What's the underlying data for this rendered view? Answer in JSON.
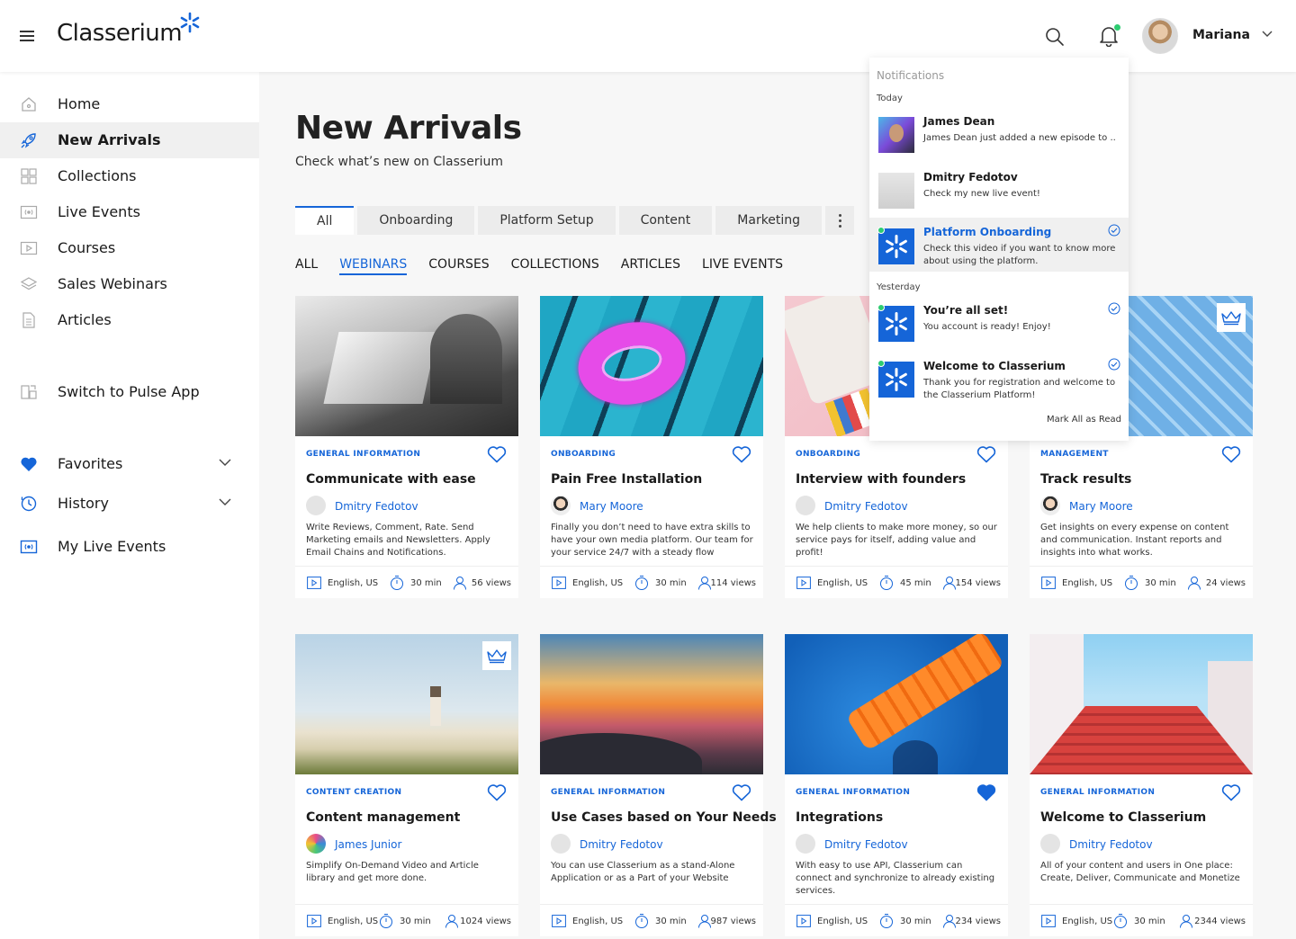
{
  "header": {
    "logo": "Classerium",
    "user_name": "Mariana"
  },
  "sidebar": {
    "items": [
      {
        "label": "Home",
        "icon": "home-icon"
      },
      {
        "label": "New Arrivals",
        "icon": "rocket-icon",
        "active": true
      },
      {
        "label": "Collections",
        "icon": "grid-icon"
      },
      {
        "label": "Live Events",
        "icon": "broadcast-icon"
      },
      {
        "label": "Courses",
        "icon": "play-icon"
      },
      {
        "label": "Sales Webinars",
        "icon": "layers-icon"
      },
      {
        "label": "Articles",
        "icon": "document-icon"
      }
    ],
    "switch_label": "Switch to Pulse App",
    "favorites_label": "Favorites",
    "history_label": "History",
    "my_live_events_label": "My Live Events"
  },
  "main": {
    "title": "New Arrivals",
    "subtitle": "Check what’s new on Classerium",
    "tabs": [
      "All",
      "Onboarding",
      "Platform Setup",
      "Content",
      "Marketing"
    ],
    "subtabs": [
      "ALL",
      "WEBINARS",
      "COURSES",
      "COLLECTIONS",
      "ARTICLES",
      "LIVE EVENTS"
    ]
  },
  "cards": [
    {
      "category": "GENERAL INFORMATION",
      "title": "Communicate with ease",
      "author": "Dmitry Fedotov",
      "desc": "Write Reviews, Comment, Rate. Send Marketing emails and Newsletters. Apply Email Chains and Notifications.",
      "lang": "English, US",
      "duration": "30 min",
      "views": "56 views"
    },
    {
      "category": "ONBOARDING",
      "title": "Pain Free Installation",
      "author": "Mary Moore",
      "desc": "Finally you don’t need to have extra skills to have your own media platform. Our team for your service 24/7 with a steady flow",
      "lang": "English, US",
      "duration": "30 min",
      "views": "114 views"
    },
    {
      "category": "ONBOARDING",
      "title": "Interview with founders",
      "author": "Dmitry Fedotov",
      "desc": "We help clients to make more money, so our service pays for itself, adding value and profit!",
      "lang": "English, US",
      "duration": "45 min",
      "views": "154 views"
    },
    {
      "category": "MANAGEMENT",
      "title": "Track results",
      "author": "Mary Moore",
      "desc": "Get insights on every expense on content and communication. Instant reports and insights into what works.",
      "lang": "English, US",
      "duration": "30 min",
      "views": "24 views"
    },
    {
      "category": "CONTENT CREATION",
      "title": "Content management",
      "author": "James Junior",
      "desc": "Simplify On-Demand Video and Article library and get more done.",
      "lang": "English, US",
      "duration": "30 min",
      "views": "1024 views"
    },
    {
      "category": "GENERAL INFORMATION",
      "title": "Use Cases based on Your Needs",
      "author": "Dmitry Fedotov",
      "desc": "You can use Classerium as a stand-Alone Application or as a Part of your Website",
      "lang": "English, US",
      "duration": "30 min",
      "views": "987 views"
    },
    {
      "category": "GENERAL INFORMATION",
      "title": "Integrations",
      "author": "Dmitry Fedotov",
      "desc": "With easy to use API, Classerium can connect and synchronize to already existing services.",
      "lang": "English, US",
      "duration": "30 min",
      "views": "234 views"
    },
    {
      "category": "GENERAL INFORMATION",
      "title": "Welcome to Classerium",
      "author": "Dmitry Fedotov",
      "desc": "All of your content and users in One place: Create, Deliver, Communicate and Monetize",
      "lang": "English, US",
      "duration": "30 min",
      "views": "2344 views"
    }
  ],
  "notifications": {
    "heading": "Notifications",
    "today_label": "Today",
    "yesterday_label": "Yesterday",
    "items": [
      {
        "name": "James Dean",
        "text": "James Dean just added a new episode to .."
      },
      {
        "name": "Dmitry Fedotov",
        "text": "Check my new live event!"
      },
      {
        "name": "Platform Onboarding",
        "text": "Check this video if you want to know more about using the platform."
      },
      {
        "name": "You’re all set!",
        "text": "You account is ready! Enjoy!"
      },
      {
        "name": "Welcome to Classerium",
        "text": "Thank you for registration and welcome to the Classerium Platform!"
      }
    ],
    "mark_all": "Mark All as Read"
  },
  "colors": {
    "accent": "#1565d8",
    "online": "#2ecc71"
  }
}
